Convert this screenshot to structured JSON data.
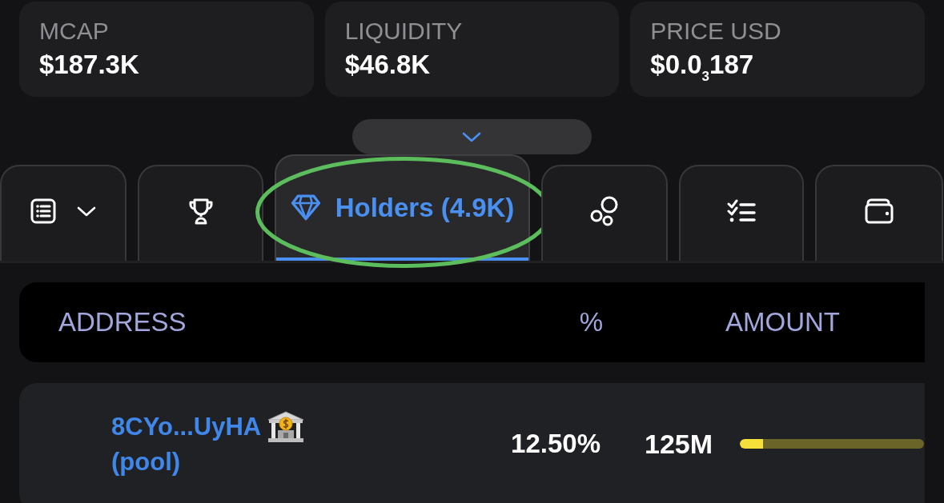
{
  "stats": [
    {
      "label": "MCAP",
      "value": "$187.3K"
    },
    {
      "label": "LIQUIDITY",
      "value": "$46.8K"
    },
    {
      "label": "PRICE USD",
      "value": "$0.0$_{3}$187"
    }
  ],
  "expand_toggle": {
    "expanded": false
  },
  "tabs": [
    {
      "kind": "dropdown",
      "selected": false,
      "circled": false
    },
    {
      "kind": "icon",
      "selected": false,
      "circled": false
    },
    {
      "kind": "label",
      "label": "Holders (4.9K)",
      "selected": true,
      "circled": true
    },
    {
      "kind": "icon",
      "selected": false,
      "circled": false
    },
    {
      "kind": "icon",
      "selected": false,
      "circled": false
    },
    {
      "kind": "icon",
      "selected": false,
      "circled": false
    }
  ],
  "table": {
    "columns": [
      "ADDRESS",
      "%",
      "AMOUNT"
    ],
    "rows": [
      {
        "address": "8CYo...UyHA",
        "tag": "(pool)",
        "percent": "12.50%",
        "amount": "125M",
        "level": 0.125
      }
    ]
  }
}
